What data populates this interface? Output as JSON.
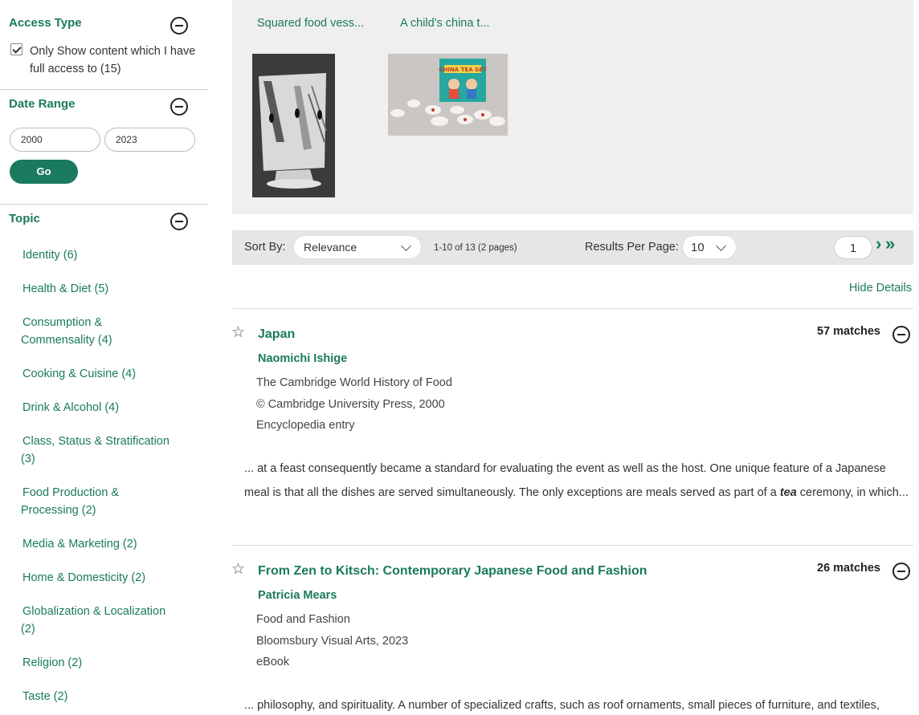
{
  "sidebar": {
    "access": {
      "title": "Access Type",
      "checkbox_label": "Only Show content which I have full access to (15)",
      "checked": true
    },
    "date": {
      "title": "Date Range",
      "from": "2000",
      "to": "2023",
      "go_label": "Go"
    },
    "topic": {
      "title": "Topic",
      "items": [
        {
          "line1": "Identity (6)",
          "line2": ""
        },
        {
          "line1": "Health & Diet (5)",
          "line2": ""
        },
        {
          "line1": "Consumption &",
          "line2": "Commensality (4)"
        },
        {
          "line1": "Cooking & Cuisine (4)",
          "line2": ""
        },
        {
          "line1": "Drink & Alcohol (4)",
          "line2": ""
        },
        {
          "line1": "Class, Status & Stratification",
          "line2": "(3)"
        },
        {
          "line1": "Food Production &",
          "line2": "Processing (2)"
        },
        {
          "line1": "Media & Marketing (2)",
          "line2": ""
        },
        {
          "line1": "Home & Domesticity (2)",
          "line2": ""
        },
        {
          "line1": "Globalization & Localization",
          "line2": "(2)"
        },
        {
          "line1": "Religion (2)",
          "line2": ""
        },
        {
          "line1": "Taste (2)",
          "line2": ""
        }
      ]
    }
  },
  "thumbnails": [
    {
      "title": "Squared food vess..."
    },
    {
      "title": "A child's china t...",
      "box_text": "CHINA TEA SET"
    }
  ],
  "sortbar": {
    "sort_label": "Sort By:",
    "sort_value": "Relevance",
    "range_text": "1-10 of 13 (2 pages)",
    "per_page_label": "Results Per Page:",
    "per_page_value": "10",
    "page_value": "1",
    "next_glyph": "›",
    "last_glyph": "»"
  },
  "hide_details": "Hide Details",
  "results": [
    {
      "title": "Japan",
      "author": "Naomichi Ishige",
      "meta": [
        "The Cambridge World History of Food",
        "© Cambridge University Press, 2000",
        "Encyclopedia entry"
      ],
      "matches": "57 matches",
      "excerpt_pre": "... at a feast consequently became a standard for evaluating the event as well as the host. One unique feature of a Japanese meal is that all the dishes are served simultaneously. The only exceptions are meals served as part of a ",
      "excerpt_em": "tea",
      "excerpt_post": " ceremony, in which..."
    },
    {
      "title": "From Zen to Kitsch: Contemporary Japanese Food and Fashion",
      "author": "Patricia Mears",
      "meta": [
        "Food and Fashion",
        "Bloomsbury Visual Arts, 2023",
        "eBook"
      ],
      "matches": "26 matches",
      "excerpt_pre": "... philosophy, and spirituality. A number of specialized crafts, such as roof ornaments, small pieces of furniture, and textiles,",
      "excerpt_em": "",
      "excerpt_post": ""
    }
  ],
  "colors": {
    "accent": "#1a7a5e",
    "panel": "#efefef",
    "sortbar": "#e6e6e6"
  }
}
